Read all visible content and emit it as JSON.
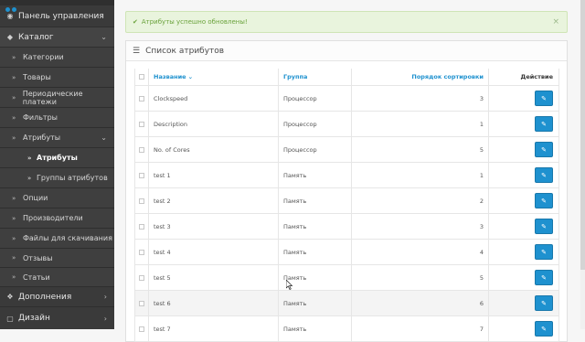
{
  "sidebar": {
    "dashboard": "Панель управления",
    "catalog": "Каталог",
    "items": [
      {
        "label": "Категории"
      },
      {
        "label": "Товары"
      },
      {
        "label": "Периодические платежи"
      },
      {
        "label": "Фильтры"
      },
      {
        "label": "Атрибуты"
      }
    ],
    "attribute_children": [
      {
        "label": "Атрибуты"
      },
      {
        "label": "Группы атрибутов"
      }
    ],
    "items_after": [
      {
        "label": "Опции"
      },
      {
        "label": "Производители"
      },
      {
        "label": "Файлы для скачивания"
      },
      {
        "label": "Отзывы"
      },
      {
        "label": "Статьи"
      }
    ],
    "extensions": "Дополнения",
    "design": "Дизайн"
  },
  "alert": {
    "text": "Атрибуты успешно обновлены!",
    "close": "×"
  },
  "panel": {
    "title": "Список атрибутов"
  },
  "table": {
    "headers": {
      "name": "Название",
      "group": "Группа",
      "sort": "Порядок сортировки",
      "action": "Действие"
    },
    "rows": [
      {
        "name": "Clockspeed",
        "group": "Процессор",
        "sort": "3"
      },
      {
        "name": "Description",
        "group": "Процессор",
        "sort": "1"
      },
      {
        "name": "No. of Cores",
        "group": "Процессор",
        "sort": "5"
      },
      {
        "name": "test 1",
        "group": "Память",
        "sort": "1"
      },
      {
        "name": "test 2",
        "group": "Память",
        "sort": "2"
      },
      {
        "name": "test 3",
        "group": "Память",
        "sort": "3"
      },
      {
        "name": "test 4",
        "group": "Память",
        "sort": "4"
      },
      {
        "name": "test 5",
        "group": "Память",
        "sort": "5"
      },
      {
        "name": "test 6",
        "group": "Память",
        "sort": "6"
      },
      {
        "name": "test 7",
        "group": "Память",
        "sort": "7"
      }
    ]
  },
  "colors": {
    "sidebar": "#3a3a3a",
    "accent": "#1e91cf",
    "success": "#6aa23b"
  }
}
